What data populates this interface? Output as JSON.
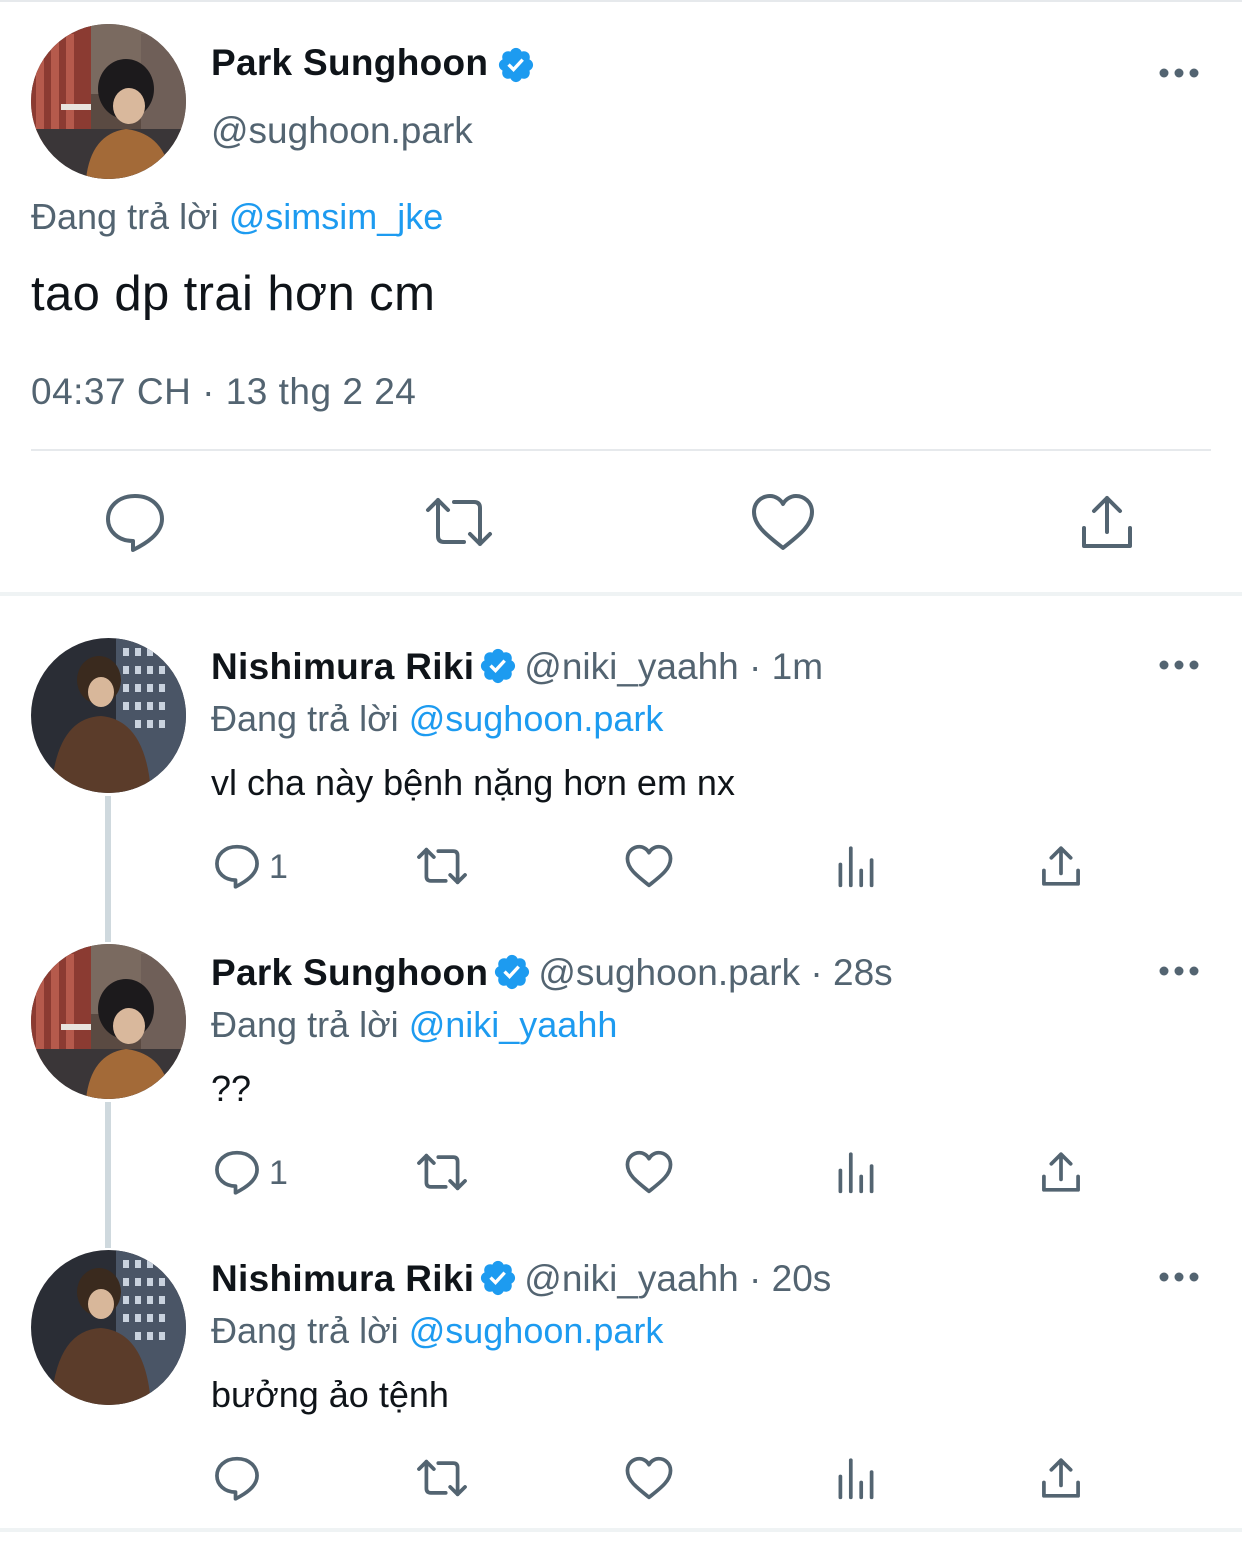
{
  "colors": {
    "accent": "#1d9bf0",
    "secondary_text": "#536471",
    "primary_text": "#0f1419",
    "divider": "#e6e9ec"
  },
  "main_tweet": {
    "name": "Park Sunghoon",
    "handle": "@sughoon.park",
    "replying_prefix": "Đang trả lời",
    "replying_to": "@simsim_jke",
    "text": "tao dp trai hơn cm",
    "timestamp": "04:37 CH · 13 thg 2 24",
    "icons": {
      "verified": "verified-badge-icon",
      "more": "more-dots-icon",
      "reply": "reply-icon",
      "retweet": "retweet-icon",
      "like": "heart-icon",
      "share": "share-icon"
    }
  },
  "replies": [
    {
      "name": "Nishimura Riki",
      "handle": "@niki_yaahh",
      "time": "· 1m",
      "replying_prefix": "Đang trả lời",
      "replying_to": "@sughoon.park",
      "text": "vl cha này bệnh nặng hơn em nx",
      "reply_count": "1"
    },
    {
      "name": "Park Sunghoon",
      "handle": "@sughoon.park",
      "time": "· 28s",
      "replying_prefix": "Đang trả lời",
      "replying_to": "@niki_yaahh",
      "text": "??",
      "reply_count": "1"
    },
    {
      "name": "Nishimura Riki",
      "handle": "@niki_yaahh",
      "time": "· 20s",
      "replying_prefix": "Đang trả lời",
      "replying_to": "@sughoon.park",
      "text": "bưởng ảo tệnh",
      "reply_count": ""
    }
  ]
}
